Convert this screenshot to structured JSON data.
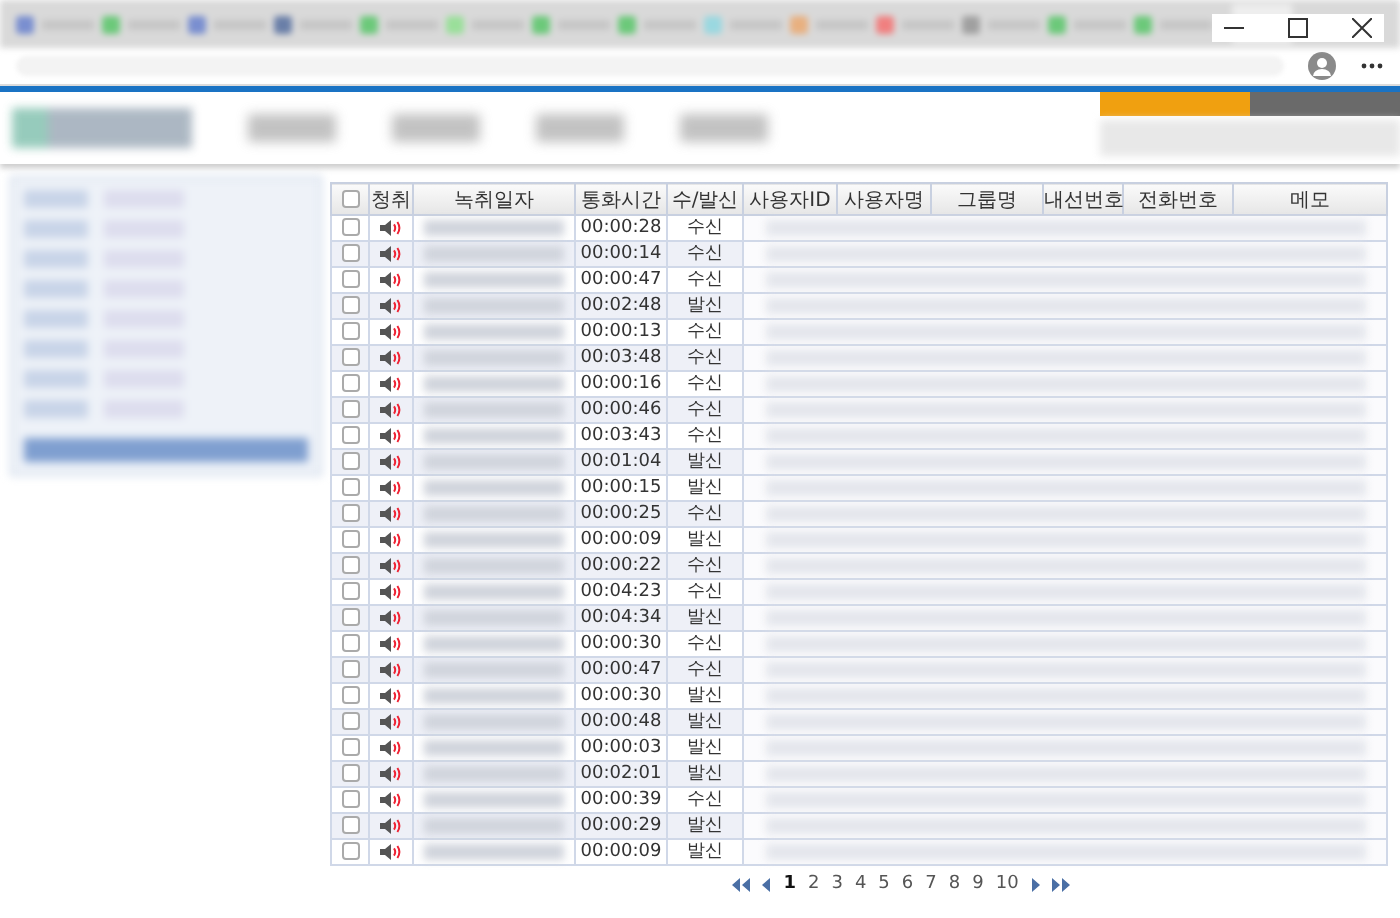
{
  "table": {
    "header_checked": false,
    "columns": [
      "청취",
      "녹취일자",
      "통화시간",
      "수/발신",
      "사용자ID",
      "사용자명",
      "그룹명",
      "내선번호",
      "전화번호",
      "메모"
    ],
    "rows": [
      {
        "checked": false,
        "duration": "00:00:28",
        "direction": "수신"
      },
      {
        "checked": false,
        "duration": "00:00:14",
        "direction": "수신"
      },
      {
        "checked": false,
        "duration": "00:00:47",
        "direction": "수신"
      },
      {
        "checked": false,
        "duration": "00:02:48",
        "direction": "발신"
      },
      {
        "checked": false,
        "duration": "00:00:13",
        "direction": "수신"
      },
      {
        "checked": false,
        "duration": "00:03:48",
        "direction": "수신"
      },
      {
        "checked": false,
        "duration": "00:00:16",
        "direction": "수신"
      },
      {
        "checked": false,
        "duration": "00:00:46",
        "direction": "수신"
      },
      {
        "checked": false,
        "duration": "00:03:43",
        "direction": "수신"
      },
      {
        "checked": false,
        "duration": "00:01:04",
        "direction": "발신"
      },
      {
        "checked": false,
        "duration": "00:00:15",
        "direction": "발신"
      },
      {
        "checked": false,
        "duration": "00:00:25",
        "direction": "수신"
      },
      {
        "checked": false,
        "duration": "00:00:09",
        "direction": "발신"
      },
      {
        "checked": false,
        "duration": "00:00:22",
        "direction": "수신"
      },
      {
        "checked": false,
        "duration": "00:04:23",
        "direction": "수신"
      },
      {
        "checked": false,
        "duration": "00:04:34",
        "direction": "발신"
      },
      {
        "checked": false,
        "duration": "00:00:30",
        "direction": "수신"
      },
      {
        "checked": false,
        "duration": "00:00:47",
        "direction": "수신"
      },
      {
        "checked": false,
        "duration": "00:00:30",
        "direction": "발신"
      },
      {
        "checked": false,
        "duration": "00:00:48",
        "direction": "발신"
      },
      {
        "checked": false,
        "duration": "00:00:03",
        "direction": "발신"
      },
      {
        "checked": false,
        "duration": "00:02:01",
        "direction": "발신"
      },
      {
        "checked": false,
        "duration": "00:00:39",
        "direction": "수신"
      },
      {
        "checked": false,
        "duration": "00:00:29",
        "direction": "발신"
      },
      {
        "checked": false,
        "duration": "00:00:09",
        "direction": "발신"
      }
    ]
  },
  "pagination": {
    "pages": [
      {
        "label": "1",
        "selected": true
      },
      {
        "label": "2",
        "selected": false
      },
      {
        "label": "3",
        "selected": false
      },
      {
        "label": "4",
        "selected": false
      },
      {
        "label": "5",
        "selected": false
      },
      {
        "label": "6",
        "selected": false
      },
      {
        "label": "7",
        "selected": false
      },
      {
        "label": "8",
        "selected": false
      },
      {
        "label": "9",
        "selected": false
      },
      {
        "label": "10",
        "selected": false
      }
    ]
  }
}
